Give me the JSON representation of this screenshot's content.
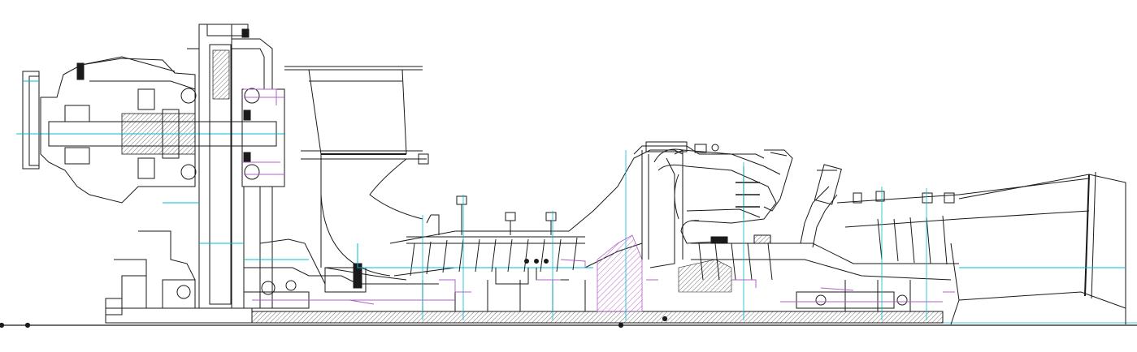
{
  "drawing": {
    "subject": "",
    "colors": {
      "background": "#ffffff",
      "line": "#1a1a1a",
      "centerline": "#00bcd4",
      "accent": "#b060c8",
      "hatch": "#c070d0"
    }
  }
}
